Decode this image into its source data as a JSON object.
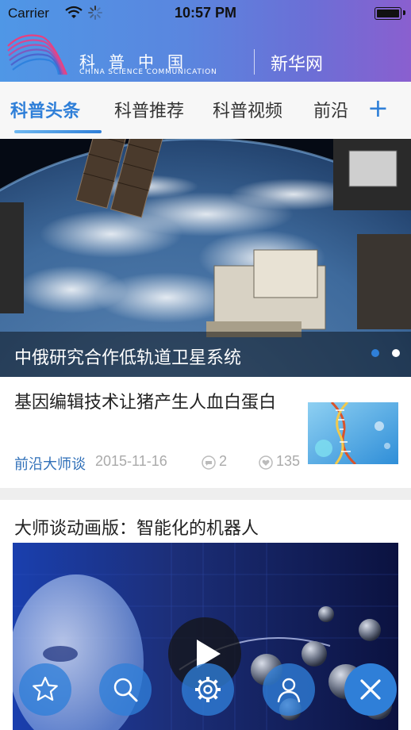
{
  "status_bar": {
    "carrier": "Carrier",
    "time": "10:57 PM"
  },
  "header": {
    "brand_title": "科普中国",
    "brand_subtitle": "CHINA SCIENCE COMMUNICATION",
    "partner": "新华网"
  },
  "tabs": {
    "items": [
      {
        "label": "科普头条",
        "active": true
      },
      {
        "label": "科普推荐",
        "active": false
      },
      {
        "label": "科普视频",
        "active": false
      },
      {
        "label": "前沿",
        "active": false
      }
    ],
    "add_label": "+"
  },
  "banner": {
    "caption": "中俄研究合作低轨道卫星系统",
    "slide_count": 2,
    "active_slide": 1
  },
  "articles": [
    {
      "title": "基因编辑技术让猪产生人血白蛋白",
      "source": "前沿大师谈",
      "date": "2015-11-16",
      "comments": "2",
      "likes": "135"
    },
    {
      "title": "大师谈动画版：智能化的机器人"
    }
  ],
  "icons": {
    "fab_favorites": "star-icon",
    "fab_search": "search-icon",
    "fab_settings": "gear-icon",
    "fab_profile": "user-icon",
    "fab_close": "close-icon",
    "video_play": "play-icon"
  },
  "colors": {
    "accent": "#2f7fd8",
    "source_text": "#2f6fb8",
    "meta_text": "#aaaaaa"
  }
}
